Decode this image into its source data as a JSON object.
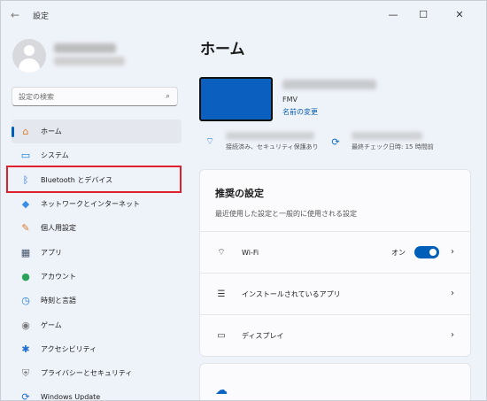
{
  "window": {
    "title": "設定",
    "back_icon": "back-arrow-icon",
    "controls": {
      "minimize": "—",
      "maximize": "☐",
      "close": "✕"
    }
  },
  "search": {
    "placeholder": "設定の検索",
    "value": ""
  },
  "sidebar": {
    "items": [
      {
        "label": "ホーム",
        "icon": "home-icon",
        "glyph": "⌂",
        "color": "#d9822b",
        "active": true
      },
      {
        "label": "システム",
        "icon": "system-icon",
        "glyph": "▭",
        "color": "#0a78d4",
        "active": false
      },
      {
        "label": "Bluetooth とデバイス",
        "icon": "bluetooth-icon",
        "glyph": "ᛒ",
        "color": "#1a73e8",
        "active": false
      },
      {
        "label": "ネットワークとインターネット",
        "icon": "network-icon",
        "glyph": "◆",
        "color": "#3a8ee6",
        "active": false
      },
      {
        "label": "個人用設定",
        "icon": "personalize-icon",
        "glyph": "✎",
        "color": "#d97a2a",
        "active": false
      },
      {
        "label": "アプリ",
        "icon": "apps-icon",
        "glyph": "▦",
        "color": "#44546a",
        "active": false
      },
      {
        "label": "アカウント",
        "icon": "account-icon",
        "glyph": "●",
        "color": "#2aa35a",
        "active": false
      },
      {
        "label": "時刻と言語",
        "icon": "time-language-icon",
        "glyph": "◷",
        "color": "#1f7fd6",
        "active": false
      },
      {
        "label": "ゲーム",
        "icon": "game-icon",
        "glyph": "◉",
        "color": "#7a7a7a",
        "active": false
      },
      {
        "label": "アクセシビリティ",
        "icon": "accessibility-icon",
        "glyph": "✱",
        "color": "#1f6fd1",
        "active": false
      },
      {
        "label": "プライバシーとセキュリティ",
        "icon": "privacy-shield-icon",
        "glyph": "⛨",
        "color": "#7b7b7b",
        "active": false
      },
      {
        "label": "Windows Update",
        "icon": "windows-update-icon",
        "glyph": "⟳",
        "color": "#1f6fd1",
        "active": false
      }
    ]
  },
  "main": {
    "title": "ホーム",
    "device": {
      "model": "FMV",
      "rename_link": "名前の変更"
    },
    "status": [
      {
        "icon": "wifi-icon",
        "glyph": "⌔",
        "text": "接続済み、セキュリティ保護あり"
      },
      {
        "icon": "update-sync-icon",
        "glyph": "⟳",
        "text": "最終チェック日時: 15 時間前"
      }
    ],
    "recommended": {
      "title": "推奨の設定",
      "subtitle": "最近使用した設定と一般的に使用される設定",
      "rows": [
        {
          "label": "Wi-Fi",
          "icon": "wifi-icon",
          "glyph": "⌔",
          "toggle_label": "オン",
          "toggle_on": true
        },
        {
          "label": "インストールされているアプリ",
          "icon": "installed-apps-icon",
          "glyph": "☰"
        },
        {
          "label": "ディスプレイ",
          "icon": "display-icon",
          "glyph": "▭"
        }
      ]
    },
    "cloud_icon": "onedrive-cloud-icon"
  },
  "colors": {
    "accent": "#005fb8",
    "highlight": "#e0202d",
    "device_thumb": "#0a5fbf"
  }
}
